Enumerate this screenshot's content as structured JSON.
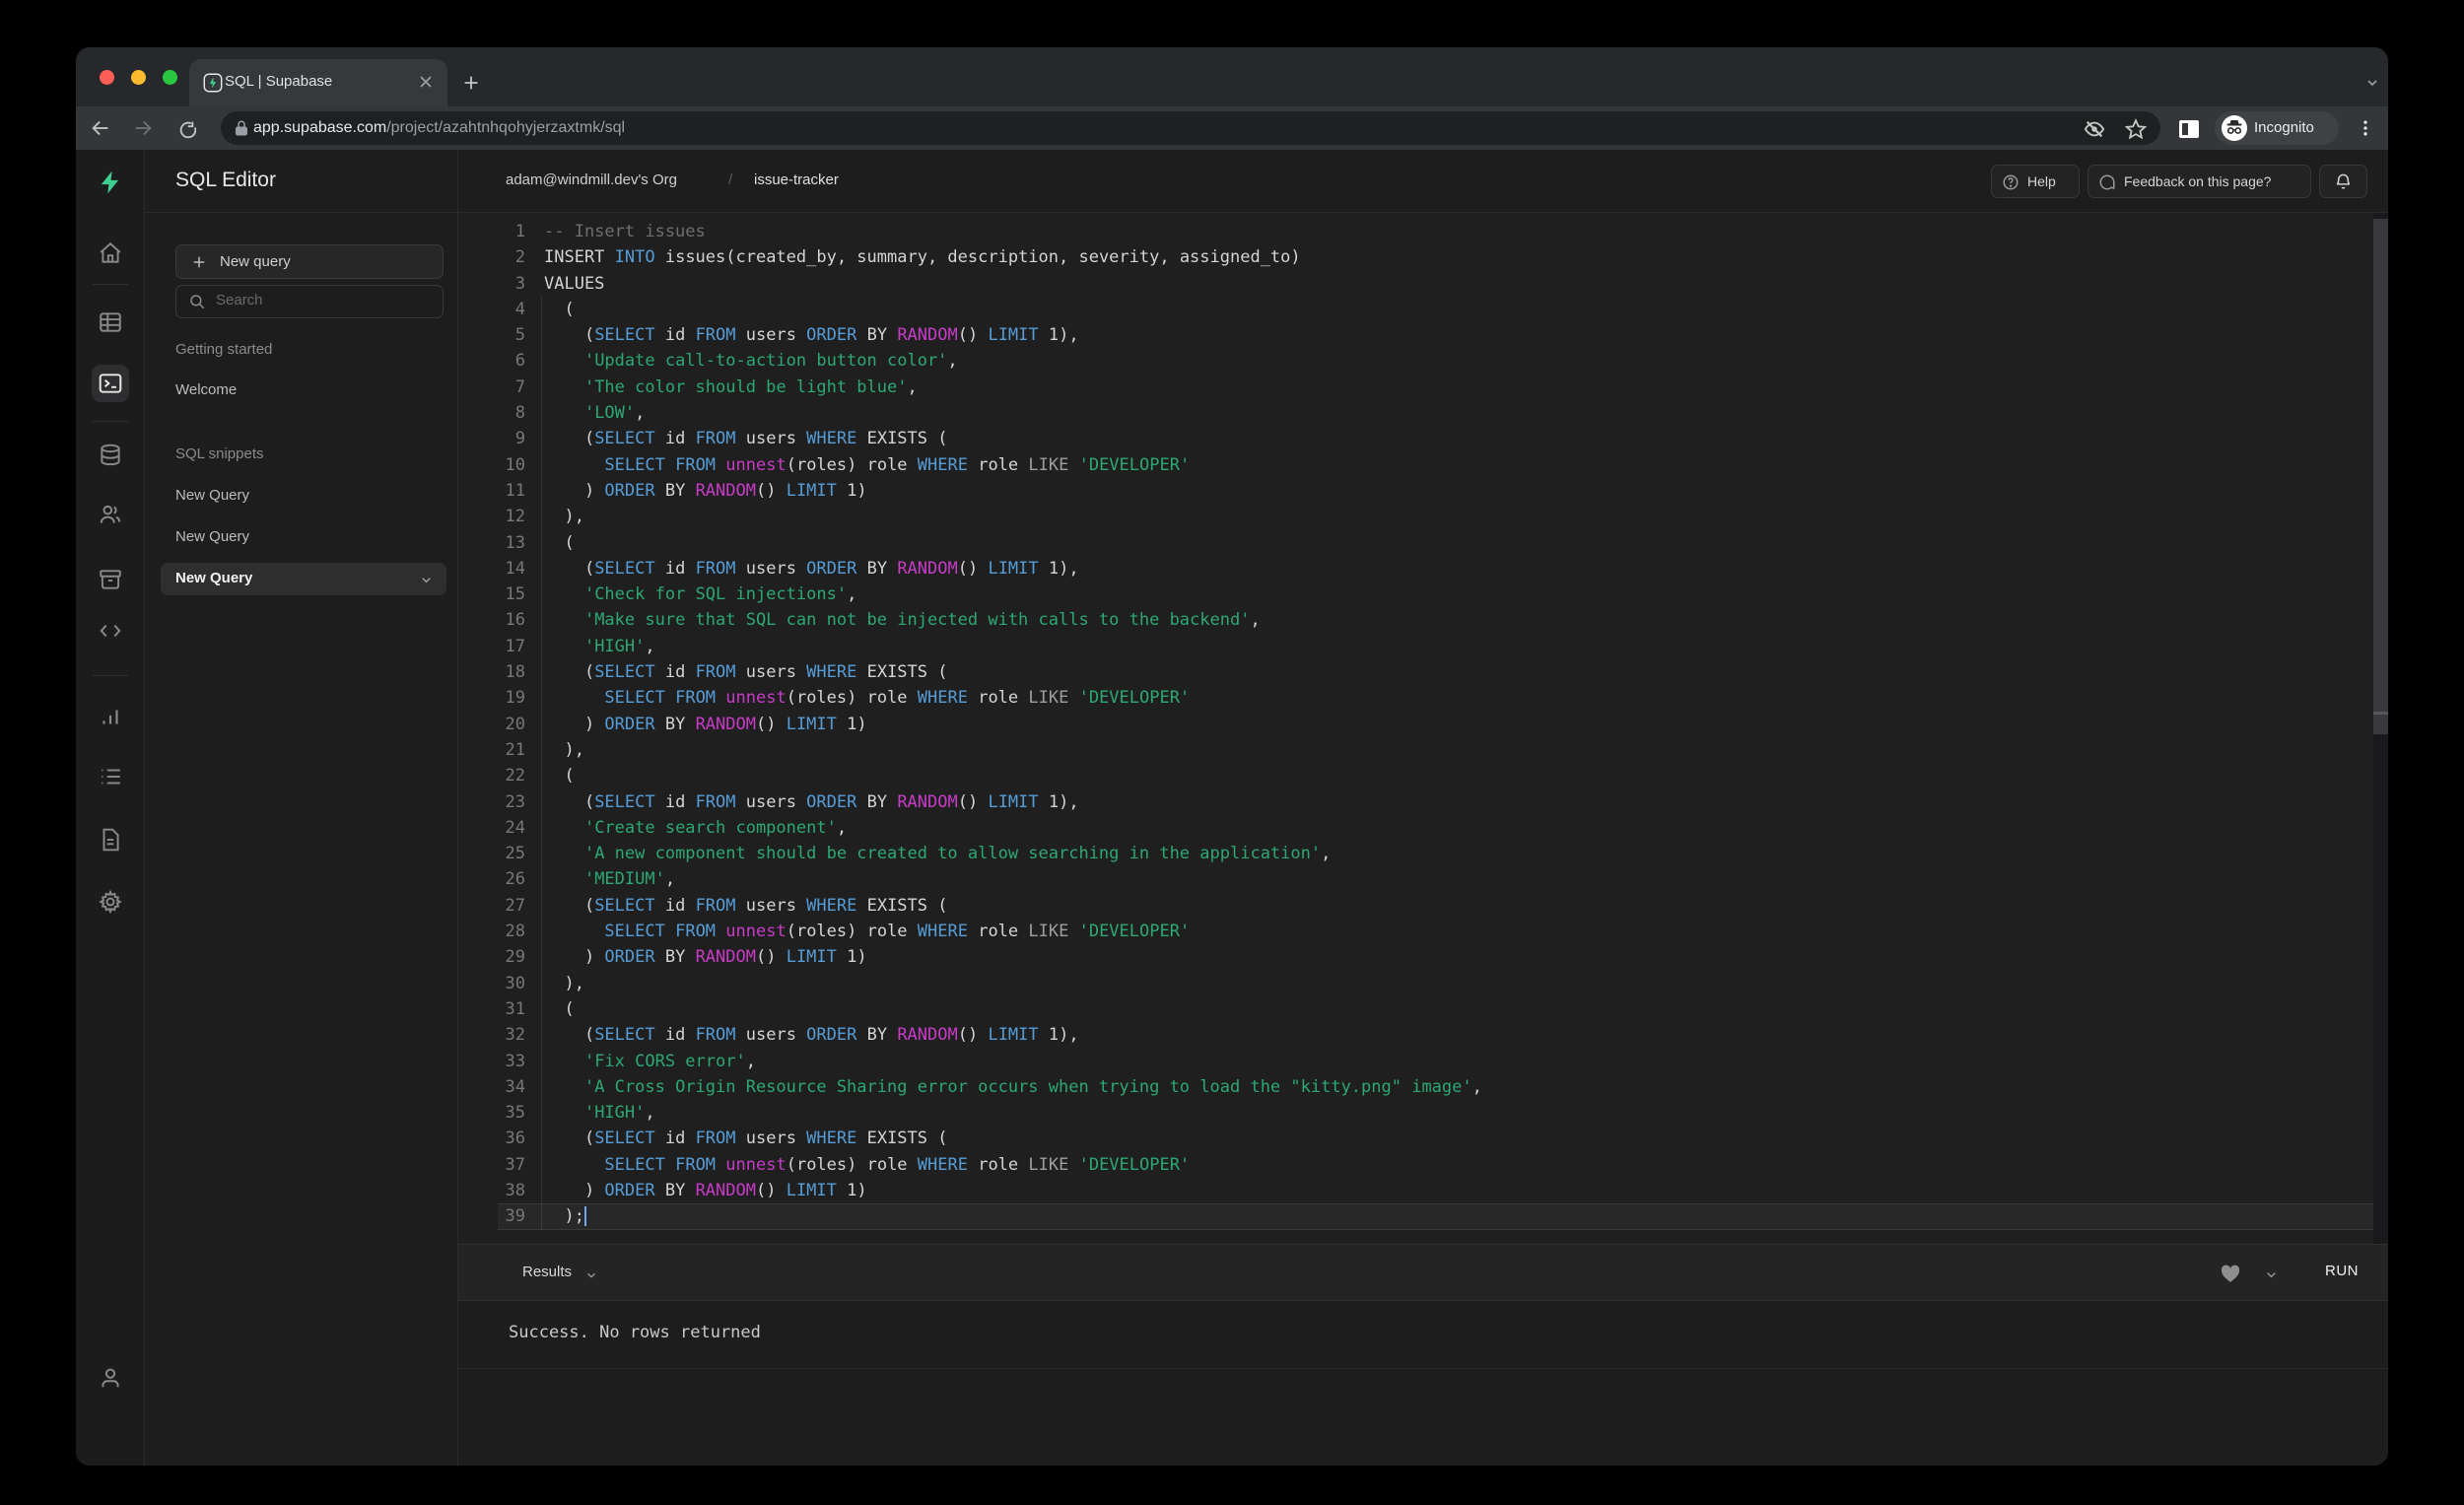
{
  "browser": {
    "tab_title": "SQL | Supabase",
    "url_host": "app.supabase.com",
    "url_path": "/project/azahtnhqohyjerzaxtmk/sql",
    "incognito_label": "Incognito"
  },
  "header": {
    "breadcrumb_org": "adam@windmill.dev's Org",
    "breadcrumb_sep": "/",
    "breadcrumb_project": "issue-tracker",
    "help_label": "Help",
    "feedback_label": "Feedback on this page?"
  },
  "sidebar": {
    "title": "SQL Editor",
    "new_query_button": "New query",
    "search_placeholder": "Search",
    "sections": [
      {
        "label": "Getting started",
        "items": [
          {
            "label": "Welcome",
            "selected": false
          }
        ]
      },
      {
        "label": "SQL snippets",
        "items": [
          {
            "label": "New Query",
            "selected": false
          },
          {
            "label": "New Query",
            "selected": false
          },
          {
            "label": "New Query",
            "selected": true
          }
        ]
      }
    ],
    "rail_icons": [
      "home",
      "table-editor",
      "sql-editor",
      "database",
      "authentication",
      "storage",
      "edge-functions",
      "reports",
      "logs",
      "api-docs",
      "settings",
      "account"
    ],
    "rail_active": "sql-editor"
  },
  "results_bar": {
    "label": "Results",
    "run_label": "RUN"
  },
  "output": {
    "message": "Success. No rows returned"
  },
  "colors": {
    "accent_green": "#3ecf8e",
    "keyword_blue": "#569cd6",
    "function_magenta": "#c73bc7",
    "string_green": "#2ca874",
    "comment_gray": "#6e6e6e",
    "traffic_red": "#ff5f57",
    "traffic_yellow": "#febc2e",
    "traffic_green": "#2ac840"
  },
  "code": {
    "lines": [
      [
        [
          "c",
          "-- Insert issues"
        ]
      ],
      [
        [
          "d",
          "INSERT "
        ],
        [
          "k",
          "INTO"
        ],
        [
          "d",
          " issues(created_by, summary, description, severity, assigned_to)"
        ]
      ],
      [
        [
          "d",
          "VALUES"
        ]
      ],
      [
        [
          "d",
          "  ("
        ]
      ],
      [
        [
          "d",
          "    ("
        ],
        [
          "k",
          "SELECT"
        ],
        [
          "d",
          " id "
        ],
        [
          "k",
          "FROM"
        ],
        [
          "d",
          " users "
        ],
        [
          "k",
          "ORDER"
        ],
        [
          "d",
          " BY "
        ],
        [
          "f",
          "RANDOM"
        ],
        [
          "d",
          "() "
        ],
        [
          "k",
          "LIMIT"
        ],
        [
          "d",
          " 1),"
        ]
      ],
      [
        [
          "d",
          "    "
        ],
        [
          "s",
          "'Update call-to-action button color'"
        ],
        [
          "d",
          ","
        ]
      ],
      [
        [
          "d",
          "    "
        ],
        [
          "s",
          "'The color should be light blue'"
        ],
        [
          "d",
          ","
        ]
      ],
      [
        [
          "d",
          "    "
        ],
        [
          "s",
          "'LOW'"
        ],
        [
          "d",
          ","
        ]
      ],
      [
        [
          "d",
          "    ("
        ],
        [
          "k",
          "SELECT"
        ],
        [
          "d",
          " id "
        ],
        [
          "k",
          "FROM"
        ],
        [
          "d",
          " users "
        ],
        [
          "k",
          "WHERE"
        ],
        [
          "d",
          " EXISTS ("
        ]
      ],
      [
        [
          "d",
          "      "
        ],
        [
          "k",
          "SELECT"
        ],
        [
          "d",
          " "
        ],
        [
          "k",
          "FROM"
        ],
        [
          "d",
          " "
        ],
        [
          "f",
          "unnest"
        ],
        [
          "d",
          "(roles) role "
        ],
        [
          "k",
          "WHERE"
        ],
        [
          "d",
          " role "
        ],
        [
          "o",
          "LIKE"
        ],
        [
          "d",
          " "
        ],
        [
          "s",
          "'DEVELOPER'"
        ]
      ],
      [
        [
          "d",
          "    ) "
        ],
        [
          "k",
          "ORDER"
        ],
        [
          "d",
          " BY "
        ],
        [
          "f",
          "RANDOM"
        ],
        [
          "d",
          "() "
        ],
        [
          "k",
          "LIMIT"
        ],
        [
          "d",
          " 1)"
        ]
      ],
      [
        [
          "d",
          "  ),"
        ]
      ],
      [
        [
          "d",
          "  ("
        ]
      ],
      [
        [
          "d",
          "    ("
        ],
        [
          "k",
          "SELECT"
        ],
        [
          "d",
          " id "
        ],
        [
          "k",
          "FROM"
        ],
        [
          "d",
          " users "
        ],
        [
          "k",
          "ORDER"
        ],
        [
          "d",
          " BY "
        ],
        [
          "f",
          "RANDOM"
        ],
        [
          "d",
          "() "
        ],
        [
          "k",
          "LIMIT"
        ],
        [
          "d",
          " 1),"
        ]
      ],
      [
        [
          "d",
          "    "
        ],
        [
          "s",
          "'Check for SQL injections'"
        ],
        [
          "d",
          ","
        ]
      ],
      [
        [
          "d",
          "    "
        ],
        [
          "s",
          "'Make sure that SQL can not be injected with calls to the backend'"
        ],
        [
          "d",
          ","
        ]
      ],
      [
        [
          "d",
          "    "
        ],
        [
          "s",
          "'HIGH'"
        ],
        [
          "d",
          ","
        ]
      ],
      [
        [
          "d",
          "    ("
        ],
        [
          "k",
          "SELECT"
        ],
        [
          "d",
          " id "
        ],
        [
          "k",
          "FROM"
        ],
        [
          "d",
          " users "
        ],
        [
          "k",
          "WHERE"
        ],
        [
          "d",
          " EXISTS ("
        ]
      ],
      [
        [
          "d",
          "      "
        ],
        [
          "k",
          "SELECT"
        ],
        [
          "d",
          " "
        ],
        [
          "k",
          "FROM"
        ],
        [
          "d",
          " "
        ],
        [
          "f",
          "unnest"
        ],
        [
          "d",
          "(roles) role "
        ],
        [
          "k",
          "WHERE"
        ],
        [
          "d",
          " role "
        ],
        [
          "o",
          "LIKE"
        ],
        [
          "d",
          " "
        ],
        [
          "s",
          "'DEVELOPER'"
        ]
      ],
      [
        [
          "d",
          "    ) "
        ],
        [
          "k",
          "ORDER"
        ],
        [
          "d",
          " BY "
        ],
        [
          "f",
          "RANDOM"
        ],
        [
          "d",
          "() "
        ],
        [
          "k",
          "LIMIT"
        ],
        [
          "d",
          " 1)"
        ]
      ],
      [
        [
          "d",
          "  ),"
        ]
      ],
      [
        [
          "d",
          "  ("
        ]
      ],
      [
        [
          "d",
          "    ("
        ],
        [
          "k",
          "SELECT"
        ],
        [
          "d",
          " id "
        ],
        [
          "k",
          "FROM"
        ],
        [
          "d",
          " users "
        ],
        [
          "k",
          "ORDER"
        ],
        [
          "d",
          " BY "
        ],
        [
          "f",
          "RANDOM"
        ],
        [
          "d",
          "() "
        ],
        [
          "k",
          "LIMIT"
        ],
        [
          "d",
          " 1),"
        ]
      ],
      [
        [
          "d",
          "    "
        ],
        [
          "s",
          "'Create search component'"
        ],
        [
          "d",
          ","
        ]
      ],
      [
        [
          "d",
          "    "
        ],
        [
          "s",
          "'A new component should be created to allow searching in the application'"
        ],
        [
          "d",
          ","
        ]
      ],
      [
        [
          "d",
          "    "
        ],
        [
          "s",
          "'MEDIUM'"
        ],
        [
          "d",
          ","
        ]
      ],
      [
        [
          "d",
          "    ("
        ],
        [
          "k",
          "SELECT"
        ],
        [
          "d",
          " id "
        ],
        [
          "k",
          "FROM"
        ],
        [
          "d",
          " users "
        ],
        [
          "k",
          "WHERE"
        ],
        [
          "d",
          " EXISTS ("
        ]
      ],
      [
        [
          "d",
          "      "
        ],
        [
          "k",
          "SELECT"
        ],
        [
          "d",
          " "
        ],
        [
          "k",
          "FROM"
        ],
        [
          "d",
          " "
        ],
        [
          "f",
          "unnest"
        ],
        [
          "d",
          "(roles) role "
        ],
        [
          "k",
          "WHERE"
        ],
        [
          "d",
          " role "
        ],
        [
          "o",
          "LIKE"
        ],
        [
          "d",
          " "
        ],
        [
          "s",
          "'DEVELOPER'"
        ]
      ],
      [
        [
          "d",
          "    ) "
        ],
        [
          "k",
          "ORDER"
        ],
        [
          "d",
          " BY "
        ],
        [
          "f",
          "RANDOM"
        ],
        [
          "d",
          "() "
        ],
        [
          "k",
          "LIMIT"
        ],
        [
          "d",
          " 1)"
        ]
      ],
      [
        [
          "d",
          "  ),"
        ]
      ],
      [
        [
          "d",
          "  ("
        ]
      ],
      [
        [
          "d",
          "    ("
        ],
        [
          "k",
          "SELECT"
        ],
        [
          "d",
          " id "
        ],
        [
          "k",
          "FROM"
        ],
        [
          "d",
          " users "
        ],
        [
          "k",
          "ORDER"
        ],
        [
          "d",
          " BY "
        ],
        [
          "f",
          "RANDOM"
        ],
        [
          "d",
          "() "
        ],
        [
          "k",
          "LIMIT"
        ],
        [
          "d",
          " 1),"
        ]
      ],
      [
        [
          "d",
          "    "
        ],
        [
          "s",
          "'Fix CORS error'"
        ],
        [
          "d",
          ","
        ]
      ],
      [
        [
          "d",
          "    "
        ],
        [
          "s",
          "'A Cross Origin Resource Sharing error occurs when trying to load the \"kitty.png\" image'"
        ],
        [
          "d",
          ","
        ]
      ],
      [
        [
          "d",
          "    "
        ],
        [
          "s",
          "'HIGH'"
        ],
        [
          "d",
          ","
        ]
      ],
      [
        [
          "d",
          "    ("
        ],
        [
          "k",
          "SELECT"
        ],
        [
          "d",
          " id "
        ],
        [
          "k",
          "FROM"
        ],
        [
          "d",
          " users "
        ],
        [
          "k",
          "WHERE"
        ],
        [
          "d",
          " EXISTS ("
        ]
      ],
      [
        [
          "d",
          "      "
        ],
        [
          "k",
          "SELECT"
        ],
        [
          "d",
          " "
        ],
        [
          "k",
          "FROM"
        ],
        [
          "d",
          " "
        ],
        [
          "f",
          "unnest"
        ],
        [
          "d",
          "(roles) role "
        ],
        [
          "k",
          "WHERE"
        ],
        [
          "d",
          " role "
        ],
        [
          "o",
          "LIKE"
        ],
        [
          "d",
          " "
        ],
        [
          "s",
          "'DEVELOPER'"
        ]
      ],
      [
        [
          "d",
          "    ) "
        ],
        [
          "k",
          "ORDER"
        ],
        [
          "d",
          " BY "
        ],
        [
          "f",
          "RANDOM"
        ],
        [
          "d",
          "() "
        ],
        [
          "k",
          "LIMIT"
        ],
        [
          "d",
          " 1)"
        ]
      ],
      [
        [
          "d",
          "  );"
        ],
        [
          "cursor",
          ""
        ]
      ]
    ]
  }
}
